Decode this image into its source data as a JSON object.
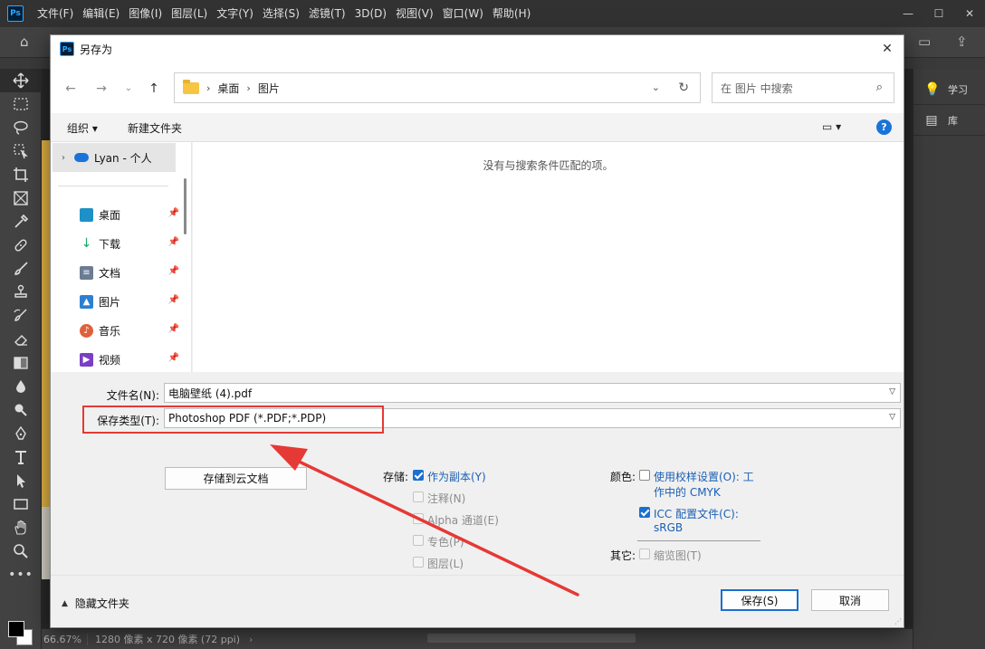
{
  "ps": {
    "menu": [
      "文件(F)",
      "编辑(E)",
      "图像(I)",
      "图层(L)",
      "文字(Y)",
      "选择(S)",
      "滤镜(T)",
      "3D(D)",
      "视图(V)",
      "窗口(W)",
      "帮助(H)"
    ],
    "logo": "Ps",
    "right_panel": [
      {
        "icon": "lightbulb-icon",
        "label": "学习"
      },
      {
        "icon": "library-icon",
        "label": "库"
      }
    ],
    "status": {
      "zoom": "66.67%",
      "info": "1280 像素 x 720 像素 (72 ppi)",
      "arrow": "›"
    }
  },
  "dialog": {
    "title": "另存为",
    "address": {
      "crumbs": [
        "桌面",
        "图片"
      ]
    },
    "search": {
      "placeholder": "在 图片 中搜索"
    },
    "cmdbar": {
      "organize": "组织 ▾",
      "new_folder": "新建文件夹"
    },
    "navpane": {
      "onedrive": "Lyan - 个人",
      "items": [
        {
          "label": "桌面",
          "color": "#1e90c8"
        },
        {
          "label": "下载",
          "color": "#1aa56b"
        },
        {
          "label": "文档",
          "color": "#6b7c93"
        },
        {
          "label": "图片",
          "color": "#2d7fd3"
        },
        {
          "label": "音乐",
          "color": "#e0603b"
        },
        {
          "label": "视频",
          "color": "#7a3fc4"
        }
      ]
    },
    "filelist": {
      "empty_message": "没有与搜索条件匹配的项。"
    },
    "filename": {
      "label": "文件名(N):",
      "value": "电脑壁纸 (4).pdf"
    },
    "filetype": {
      "label": "保存类型(T):",
      "value": "Photoshop PDF (*.PDF;*.PDP)"
    },
    "cloud_button": "存储到云文档",
    "save_options": {
      "label": "存储:",
      "as_copy": "作为副本(Y)",
      "notes": "注释(N)",
      "alpha": "Alpha 通道(E)",
      "spot": "专色(P)",
      "layers": "图层(L)"
    },
    "color_options": {
      "label": "颜色:",
      "proof_line1": "使用校样设置(O):  工",
      "proof_line2": "作中的 CMYK",
      "icc_line1": "ICC 配置文件(C):",
      "icc_line2": "sRGB"
    },
    "other_options": {
      "label": "其它:",
      "thumbnail": "缩览图(T)"
    },
    "footer": {
      "hide_folders": "隐藏文件夹",
      "save": "保存(S)",
      "cancel": "取消"
    }
  },
  "annotation": {
    "color": "#e53935"
  }
}
